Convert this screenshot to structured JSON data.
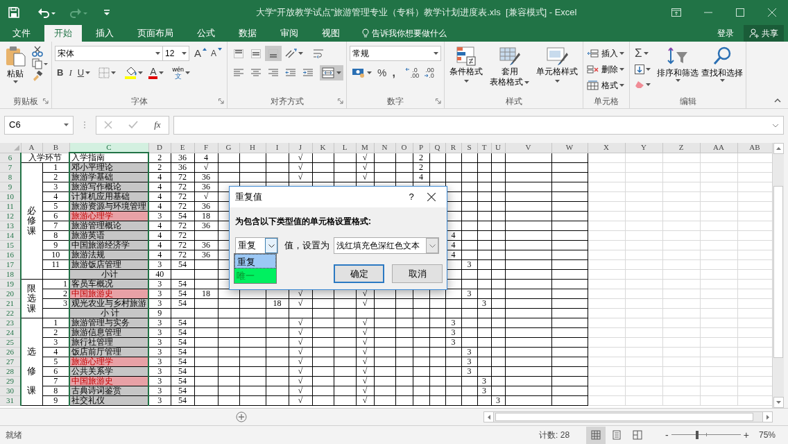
{
  "title_bar": {
    "title": "大学“开放教学试点”旅游管理专业（专科）教学计划进度表.xls  [兼容模式] - Excel",
    "quick_access": [
      {
        "kind": "save",
        "disabled": false
      },
      {
        "kind": "undo",
        "disabled": false
      },
      {
        "kind": "redo",
        "disabled": true
      },
      {
        "kind": "customize",
        "disabled": false
      }
    ]
  },
  "tabs": [
    {
      "label": "文件",
      "selected": false
    },
    {
      "label": "开始",
      "selected": true
    },
    {
      "label": "插入",
      "selected": false
    },
    {
      "label": "页面布局",
      "selected": false
    },
    {
      "label": "公式",
      "selected": false
    },
    {
      "label": "数据",
      "selected": false
    },
    {
      "label": "审阅",
      "selected": false
    },
    {
      "label": "视图",
      "selected": false
    }
  ],
  "tell_me": "告诉我你想要做什么",
  "sign_in": "登录",
  "share": "共享",
  "ribbon": {
    "clipboard": {
      "label": "剪贴板",
      "launcher": true,
      "paste": "粘贴"
    },
    "font": {
      "label": "字体",
      "launcher": true,
      "font": "宋体",
      "size": "12",
      "grow": "A",
      "shrink": "A",
      "bold": "B",
      "italic": "I",
      "underline": "U",
      "font_color": "A",
      "phonetic_top": "wén",
      "phonetic_bottom": "文"
    },
    "alignment": {
      "label": "对齐方式",
      "launcher": true,
      "vertical": [
        {
          "pressed": false
        },
        {
          "pressed": false
        },
        {
          "pressed": true
        }
      ],
      "merge_pressed": true
    },
    "number": {
      "label": "数字",
      "launcher": true,
      "format": "常规",
      "percent": "%",
      "comma": ",",
      "decimal_more": [
        ".0",
        ".00"
      ],
      "decimal_less": [
        ".00",
        ".0"
      ]
    },
    "styles": {
      "label": "样式",
      "launcher": false,
      "buttons": [
        {
          "lines": [
            "条件格式"
          ]
        },
        {
          "lines": [
            "套用",
            "表格格式"
          ]
        },
        {
          "lines": [
            "单元格样式"
          ]
        }
      ]
    },
    "cells": {
      "label": "单元格",
      "launcher": false,
      "buttons": [
        "插入",
        "删除",
        "格式"
      ]
    },
    "editing": {
      "label": "编辑",
      "launcher": false,
      "sum": "Σ",
      "buttons": [
        "排序和筛选",
        "查找和选择"
      ]
    }
  },
  "formula_bar": {
    "name_box": "C6",
    "fx": "fx"
  },
  "sheet": {
    "columns": [
      {
        "label": "A",
        "selected": false
      },
      {
        "label": "B",
        "selected": false
      },
      {
        "label": "C",
        "selected": true
      },
      {
        "label": "D",
        "selected": false
      },
      {
        "label": "E",
        "selected": false
      },
      {
        "label": "F",
        "selected": false
      },
      {
        "label": "G",
        "selected": false
      },
      {
        "label": "H",
        "selected": false
      },
      {
        "label": "I",
        "selected": false
      },
      {
        "label": "J",
        "selected": false
      },
      {
        "label": "K",
        "selected": false
      },
      {
        "label": "L",
        "selected": false
      },
      {
        "label": "M",
        "selected": false
      },
      {
        "label": "N",
        "selected": false
      },
      {
        "label": "O",
        "selected": false
      },
      {
        "label": "P",
        "selected": false
      },
      {
        "label": "Q",
        "selected": false
      },
      {
        "label": "R",
        "selected": false
      },
      {
        "label": "S",
        "selected": false
      },
      {
        "label": "T",
        "selected": false
      },
      {
        "label": "U",
        "selected": false
      },
      {
        "label": "V",
        "selected": false
      },
      {
        "label": "W",
        "selected": false
      },
      {
        "label": "X",
        "selected": false
      },
      {
        "label": "Y",
        "selected": false
      },
      {
        "label": "Z",
        "selected": false
      },
      {
        "label": "AA",
        "selected": false
      },
      {
        "label": "AB",
        "selected": false
      }
    ],
    "sections": [
      {
        "label": "入学环节",
        "kind": "row",
        "rows": [
          {
            "kind": "course",
            "num": "6",
            "selected": true,
            "name_selected": false,
            "duplicate": false,
            "cells": {
              "c": "入学指南",
              "d": "2",
              "e": "36",
              "f": "4",
              "j": "√",
              "m": "√",
              "p": "2"
            }
          }
        ]
      },
      {
        "label": "必修课",
        "kind": "stacked",
        "numbers_right": false,
        "rows": [
          {
            "kind": "course",
            "num": "7",
            "selected": true,
            "name_selected": true,
            "duplicate": false,
            "cells": {
              "b": "1",
              "c": "邓小平理论",
              "d": "2",
              "e": "36",
              "f": "√",
              "j": "√",
              "m": "√",
              "p": "2"
            }
          },
          {
            "kind": "course",
            "num": "8",
            "selected": true,
            "name_selected": true,
            "duplicate": false,
            "cells": {
              "b": "2",
              "c": "旅游学基础",
              "d": "4",
              "e": "72",
              "f": "36",
              "j": "√",
              "m": "√",
              "p": "4"
            }
          },
          {
            "kind": "course",
            "num": "9",
            "selected": true,
            "name_selected": true,
            "duplicate": false,
            "cells": {
              "b": "3",
              "c": "旅游写作概论",
              "d": "4",
              "e": "72",
              "f": "36"
            }
          },
          {
            "kind": "course",
            "num": "10",
            "selected": true,
            "name_selected": true,
            "duplicate": false,
            "cells": {
              "b": "4",
              "c": "计算机应用基础",
              "d": "4",
              "e": "72",
              "f": "√"
            }
          },
          {
            "kind": "course",
            "num": "11",
            "selected": true,
            "name_selected": true,
            "duplicate": false,
            "cells": {
              "b": "5",
              "c": "旅游资源与环境管理",
              "d": "4",
              "e": "72",
              "f": "36"
            }
          },
          {
            "kind": "course",
            "num": "12",
            "selected": true,
            "duplicate": true,
            "cells": {
              "b": "6",
              "c": "旅游心理学",
              "d": "3",
              "e": "54",
              "f": "18"
            }
          },
          {
            "kind": "course",
            "num": "13",
            "selected": true,
            "name_selected": true,
            "duplicate": false,
            "cells": {
              "b": "7",
              "c": "旅游管理概论",
              "d": "4",
              "e": "72",
              "f": "36"
            }
          },
          {
            "kind": "course",
            "num": "14",
            "selected": true,
            "name_selected": true,
            "duplicate": false,
            "cells": {
              "b": "8",
              "c": "旅游英语",
              "d": "4",
              "e": "72",
              "r": "4"
            }
          },
          {
            "kind": "course",
            "num": "15",
            "selected": true,
            "name_selected": true,
            "duplicate": false,
            "cells": {
              "b": "9",
              "c": "中国旅游经济学",
              "d": "4",
              "e": "72",
              "f": "36",
              "r": "4"
            }
          },
          {
            "kind": "course",
            "num": "16",
            "selected": true,
            "name_selected": true,
            "duplicate": false,
            "cells": {
              "b": "10",
              "c": "旅游法规",
              "d": "4",
              "e": "72",
              "f": "36",
              "r": "4"
            }
          },
          {
            "kind": "course",
            "num": "17",
            "selected": true,
            "name_selected": true,
            "duplicate": false,
            "cells": {
              "b": "11",
              "c": "旅游饭店管理",
              "d": "3",
              "e": "54",
              "s": "3"
            }
          },
          {
            "kind": "subtotal",
            "num": "18",
            "selected": true,
            "name_selected": true,
            "duplicate": false,
            "cells": {
              "c": "小计",
              "d": "40"
            }
          }
        ]
      },
      {
        "label": "限选课",
        "kind": "stacked",
        "numbers_right": true,
        "rows": [
          {
            "kind": "course",
            "num": "19",
            "selected": true,
            "name_selected": true,
            "duplicate": false,
            "cells": {
              "b": "1",
              "c": "客员车概况",
              "d": "3",
              "e": "54"
            }
          },
          {
            "kind": "course",
            "num": "20",
            "selected": true,
            "duplicate": true,
            "cells": {
              "b": "2",
              "c": "中国旅游史",
              "d": "3",
              "e": "54",
              "f": "18",
              "j": "√",
              "m": "√",
              "s": "3"
            }
          },
          {
            "kind": "course",
            "num": "21",
            "selected": true,
            "name_selected": true,
            "duplicate": false,
            "cells": {
              "b": "3",
              "c": "观光农业与乡村旅游",
              "d": "3",
              "e": "54",
              "i": "18",
              "j": "√",
              "m": "√",
              "t": "3"
            }
          },
          {
            "kind": "subtotal",
            "num": "22",
            "selected": true,
            "name_selected": true,
            "duplicate": false,
            "cells": {
              "c": "小 计",
              "d": "9"
            }
          }
        ]
      },
      {
        "label": "选修课",
        "kind": "spread",
        "numbers_right": false,
        "rows": [
          {
            "kind": "course",
            "num": "23",
            "selected": true,
            "name_selected": true,
            "duplicate": false,
            "cells": {
              "b": "1",
              "c": "旅游管理与实务",
              "d": "3",
              "e": "54",
              "j": "√",
              "m": "√",
              "r": "3"
            }
          },
          {
            "kind": "course",
            "num": "24",
            "selected": true,
            "name_selected": true,
            "duplicate": false,
            "cells": {
              "b": "2",
              "c": "旅游信息管理",
              "d": "3",
              "e": "54",
              "j": "√",
              "m": "√",
              "r": "3"
            }
          },
          {
            "kind": "course",
            "num": "25",
            "selected": true,
            "name_selected": true,
            "duplicate": false,
            "cells": {
              "b": "3",
              "c": "旅行社管理",
              "d": "3",
              "e": "54",
              "j": "√",
              "m": "√",
              "r": "3"
            }
          },
          {
            "kind": "course",
            "num": "26",
            "selected": true,
            "name_selected": true,
            "duplicate": false,
            "cells": {
              "b": "4",
              "c": "饭店前厅管理",
              "d": "3",
              "e": "54",
              "j": "√",
              "m": "√",
              "s": "3"
            }
          },
          {
            "kind": "course",
            "num": "27",
            "selected": true,
            "duplicate": true,
            "cells": {
              "b": "5",
              "c": "旅游心理学",
              "d": "3",
              "e": "54",
              "j": "√",
              "m": "√",
              "s": "3"
            }
          },
          {
            "kind": "course",
            "num": "28",
            "selected": true,
            "name_selected": true,
            "duplicate": false,
            "cells": {
              "b": "6",
              "c": "公共关系学",
              "d": "3",
              "e": "54",
              "j": "√",
              "m": "√",
              "s": "3"
            }
          },
          {
            "kind": "course",
            "num": "29",
            "selected": true,
            "duplicate": true,
            "cells": {
              "b": "7",
              "c": "中国旅游史",
              "d": "3",
              "e": "54",
              "j": "√",
              "m": "√",
              "t": "3"
            }
          },
          {
            "kind": "course",
            "num": "30",
            "selected": true,
            "name_selected": true,
            "duplicate": false,
            "cells": {
              "b": "8",
              "c": "古典诗词鉴赏",
              "d": "3",
              "e": "54",
              "j": "√",
              "m": "√",
              "t": "3"
            }
          },
          {
            "kind": "course",
            "num": "31",
            "selected": true,
            "name_selected": true,
            "duplicate": false,
            "cells": {
              "b": "9",
              "c": "社交礼仪",
              "d": "3",
              "e": "54",
              "j": "√",
              "m": "√",
              "u": "3"
            }
          }
        ]
      }
    ]
  },
  "dialog": {
    "title": "重复值",
    "help": "?",
    "instruction": "为包含以下类型值的单元格设置格式:",
    "type_value": "重复",
    "middle_label": "值，设置为",
    "format_value": "浅红填充色深红色文本",
    "options": [
      {
        "label": "重复",
        "selected": true,
        "highlighted": false
      },
      {
        "label": "唯一",
        "selected": false,
        "highlighted": true
      }
    ],
    "buttons": [
      {
        "label": "确定",
        "default": true
      },
      {
        "label": "取消",
        "default": false
      }
    ]
  },
  "status_bar": {
    "status": "就绪",
    "count": "计数: 28",
    "views": [
      {
        "selected": true
      },
      {
        "selected": false
      },
      {
        "selected": false
      }
    ],
    "zoom_out": "-",
    "zoom_in": "+",
    "zoom": {
      "level": 0.37
    },
    "zoom_reading": "75%"
  }
}
